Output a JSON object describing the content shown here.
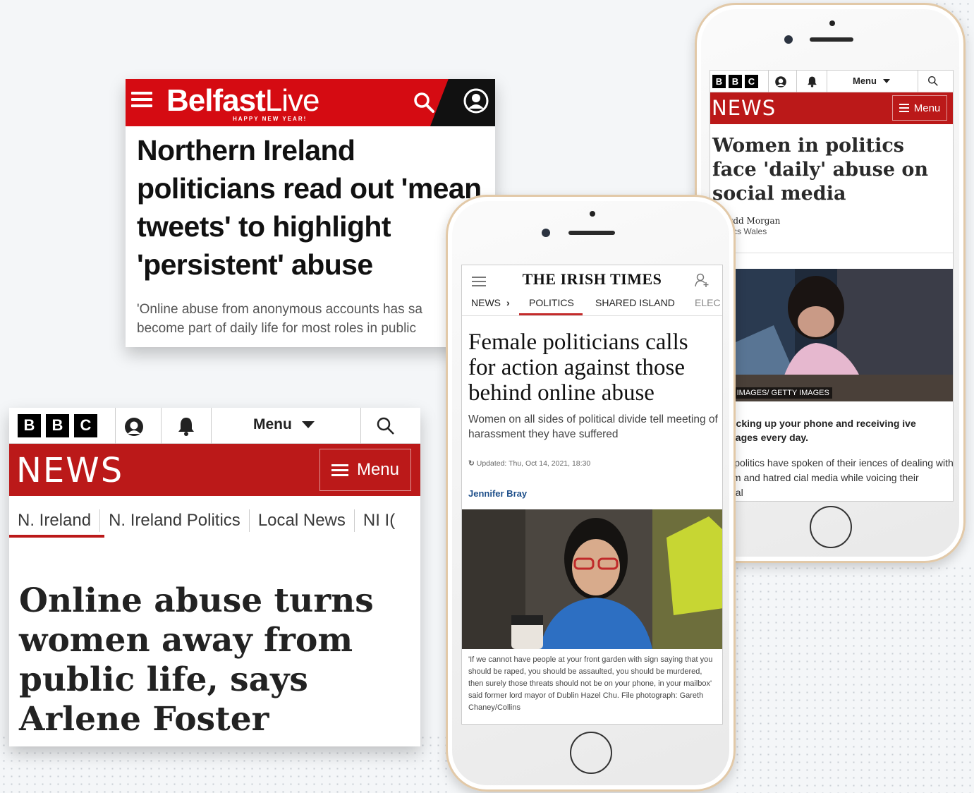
{
  "belfast_live": {
    "logo_bold": "Belfast",
    "logo_light": "Live",
    "logo_sub": "HAPPY NEW YEAR!",
    "headline": "Northern Ireland politicians read out 'mean tweets' to highlight 'persistent' abuse",
    "desc_line1": "'Online abuse from anonymous accounts has sa",
    "desc_line2": "become part of daily life for most roles in public"
  },
  "bbc_left": {
    "logo_letters": [
      "B",
      "B",
      "C"
    ],
    "menu_top_label": "Menu",
    "news_label": "NEWS",
    "menu_button_label": "Menu",
    "subnav": [
      "N. Ireland",
      "N. Ireland Politics",
      "Local News",
      "NI I("
    ],
    "headline": "Online abuse turns women away from public life, says Arlene Foster"
  },
  "bbc_right": {
    "logo_letters": [
      "B",
      "B",
      "C"
    ],
    "menu_top_label": "Menu",
    "news_label": "NEWS",
    "menu_button_label": "Menu",
    "headline": "Women in politics face 'daily' abuse on social media",
    "byline_name": "afydd Morgan",
    "byline_role": "olitics Wales",
    "photo_credit": "STEM IMAGES/ GETTY IMAGES",
    "lead": "ine picking up your phone and receiving ive messages every day.",
    "body": "en in politics have spoken of their iences of dealing with sexism and hatred cial media while voicing their political"
  },
  "irish_times": {
    "logo": "THE IRISH TIMES",
    "nav": [
      "NEWS",
      "›",
      "POLITICS",
      "SHARED ISLAND",
      "ELEC"
    ],
    "headline": "Female politicians calls for action against those behind online abuse",
    "subhead": "Women on all sides of political divide tell meeting of harassment they have suffered",
    "updated": "Updated: Thu, Oct 14, 2021, 18:30",
    "author": "Jennifer Bray",
    "caption": "'If we cannot have people at your front garden with sign saying that you should be raped, you should be assaulted, you should be murdered, then surely those threats should not be on your phone, in your mailbox' said former lord mayor of Dublin Hazel Chu. File photograph: Gareth Chaney/Collins"
  },
  "colors": {
    "belfast_red": "#d50b12",
    "bbc_red": "#bb1919",
    "irish_times_accent": "#c42b2b",
    "author_blue": "#1e4f8a"
  }
}
